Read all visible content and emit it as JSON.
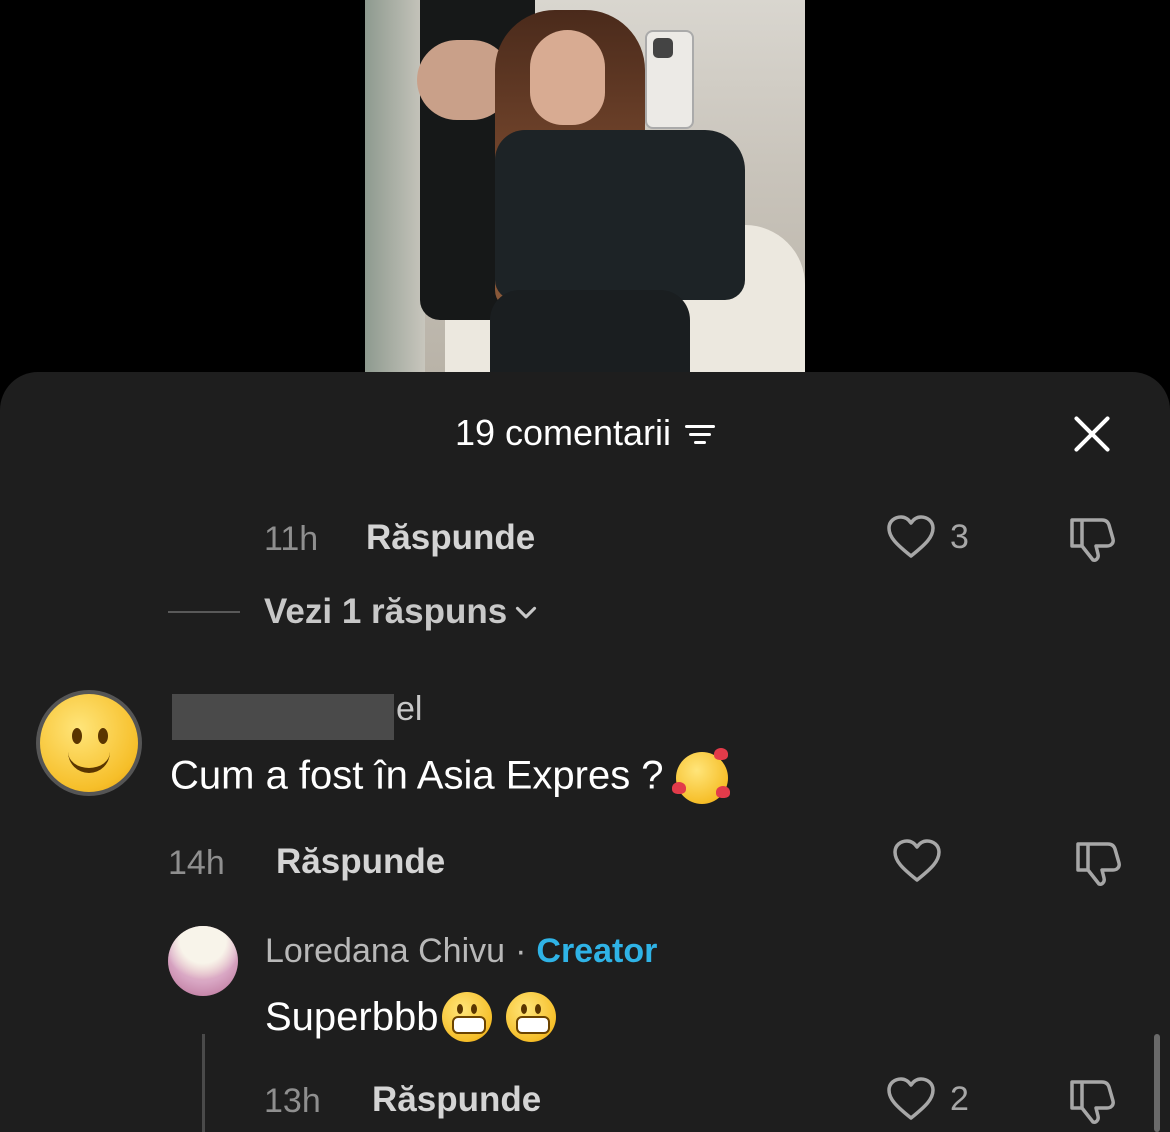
{
  "header": {
    "title": "19 comentarii"
  },
  "comment_prev": {
    "time": "11h",
    "reply": "Răspunde",
    "likes": "3"
  },
  "view_replies": "Vezi 1 răspuns",
  "comment_main": {
    "name_tail": "el",
    "text": "Cum a fost în Asia Expres ?",
    "time": "14h",
    "reply": "Răspunde",
    "likes": ""
  },
  "reply": {
    "name": "Loredana Chivu",
    "separator": "·",
    "badge": "Creator",
    "text": "Superbbb",
    "time": "13h",
    "reply": "Răspunde",
    "likes": "2"
  },
  "colors": {
    "sheet": "#1e1e1e",
    "creator": "#2fb3e6",
    "muted": "#8f8f8f"
  },
  "icons": [
    "filter-icon",
    "close-icon",
    "heart-icon",
    "dislike-icon",
    "chevron-down-icon",
    "slightly-smiling-face-emoji",
    "smiling-face-with-hearts-emoji",
    "grimacing-face-emoji"
  ]
}
